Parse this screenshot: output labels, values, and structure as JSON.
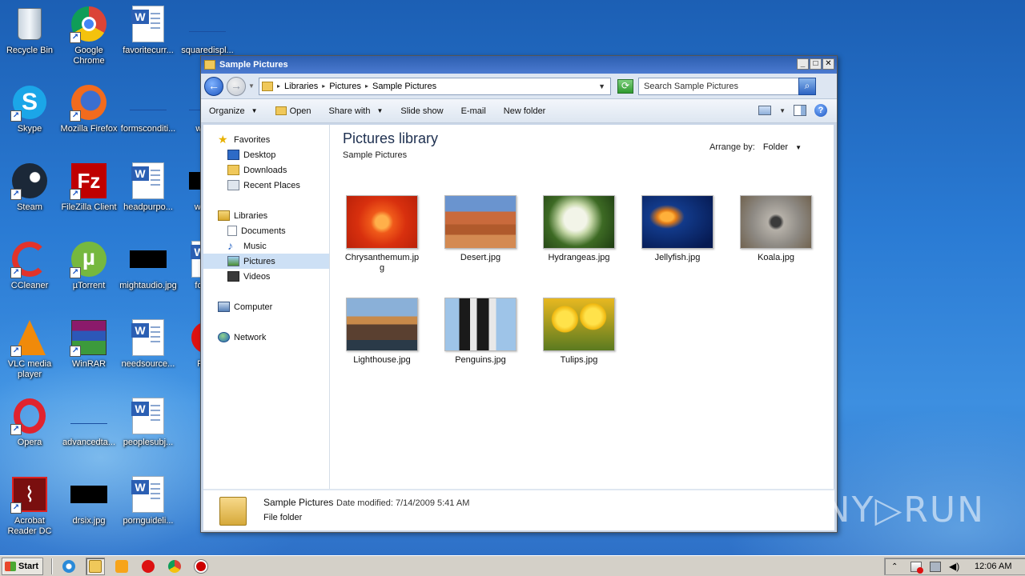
{
  "desktop": {
    "icons": [
      {
        "label": "Recycle Bin",
        "icon": "recycle-bin-icon"
      },
      {
        "label": "Google Chrome",
        "icon": "chrome-icon"
      },
      {
        "label": "favoritecurr...",
        "icon": "word-doc-icon"
      },
      {
        "label": "squaredispl...",
        "icon": "blank-file-icon"
      },
      {
        "label": "Skype",
        "icon": "skype-icon"
      },
      {
        "label": "Mozilla Firefox",
        "icon": "firefox-icon"
      },
      {
        "label": "formsconditi...",
        "icon": "blank-file-icon"
      },
      {
        "label": "warl...",
        "icon": "blank-file-icon"
      },
      {
        "label": "Steam",
        "icon": "steam-icon"
      },
      {
        "label": "FileZilla Client",
        "icon": "filezilla-icon"
      },
      {
        "label": "headpurpo...",
        "icon": "word-doc-icon"
      },
      {
        "label": "what...",
        "icon": "black-file-icon"
      },
      {
        "label": "CCleaner",
        "icon": "ccleaner-icon"
      },
      {
        "label": "µTorrent",
        "icon": "utorrent-icon"
      },
      {
        "label": "mightaudio.jpg",
        "icon": "black-file-icon"
      },
      {
        "label": "form...",
        "icon": "word-doc-icon"
      },
      {
        "label": "VLC media player",
        "icon": "vlc-icon"
      },
      {
        "label": "WinRAR",
        "icon": "winrar-icon"
      },
      {
        "label": "needsource...",
        "icon": "word-doc-icon"
      },
      {
        "label": "RO...",
        "icon": "red-circle-icon"
      },
      {
        "label": "Opera",
        "icon": "opera-icon"
      },
      {
        "label": "advancedta...",
        "icon": "blank-file-icon"
      },
      {
        "label": "peoplesubj...",
        "icon": "word-doc-icon"
      },
      {
        "label": "Acrobat Reader DC",
        "icon": "acrobat-icon"
      },
      {
        "label": "drsix.jpg",
        "icon": "black-file-icon"
      },
      {
        "label": "pornguideli...",
        "icon": "word-doc-icon"
      }
    ]
  },
  "window": {
    "title": "Sample Pictures",
    "address": {
      "crumbs": [
        "Libraries",
        "Pictures",
        "Sample Pictures"
      ]
    },
    "search_placeholder": "Search Sample Pictures",
    "toolbar": {
      "organize": "Organize",
      "open": "Open",
      "share_with": "Share with",
      "slide_show": "Slide show",
      "email": "E-mail",
      "new_folder": "New folder"
    },
    "nav": {
      "favorites": "Favorites",
      "desktop": "Desktop",
      "downloads": "Downloads",
      "recent_places": "Recent Places",
      "libraries": "Libraries",
      "documents": "Documents",
      "music": "Music",
      "pictures": "Pictures",
      "videos": "Videos",
      "computer": "Computer",
      "network": "Network"
    },
    "main": {
      "title": "Pictures library",
      "subtitle": "Sample Pictures",
      "arrange_label": "Arrange by:",
      "arrange_value": "Folder",
      "files": [
        {
          "name": "Chrysanthemum.jpg"
        },
        {
          "name": "Desert.jpg"
        },
        {
          "name": "Hydrangeas.jpg"
        },
        {
          "name": "Jellyfish.jpg"
        },
        {
          "name": "Koala.jpg"
        },
        {
          "name": "Lighthouse.jpg"
        },
        {
          "name": "Penguins.jpg"
        },
        {
          "name": "Tulips.jpg"
        }
      ]
    },
    "status": {
      "name": "Sample Pictures",
      "date_label": "Date modified:",
      "date_value": "7/14/2009 5:41 AM",
      "type": "File folder"
    }
  },
  "watermark": "ANY▷RUN",
  "taskbar": {
    "start": "Start",
    "clock": "12:06 AM"
  }
}
